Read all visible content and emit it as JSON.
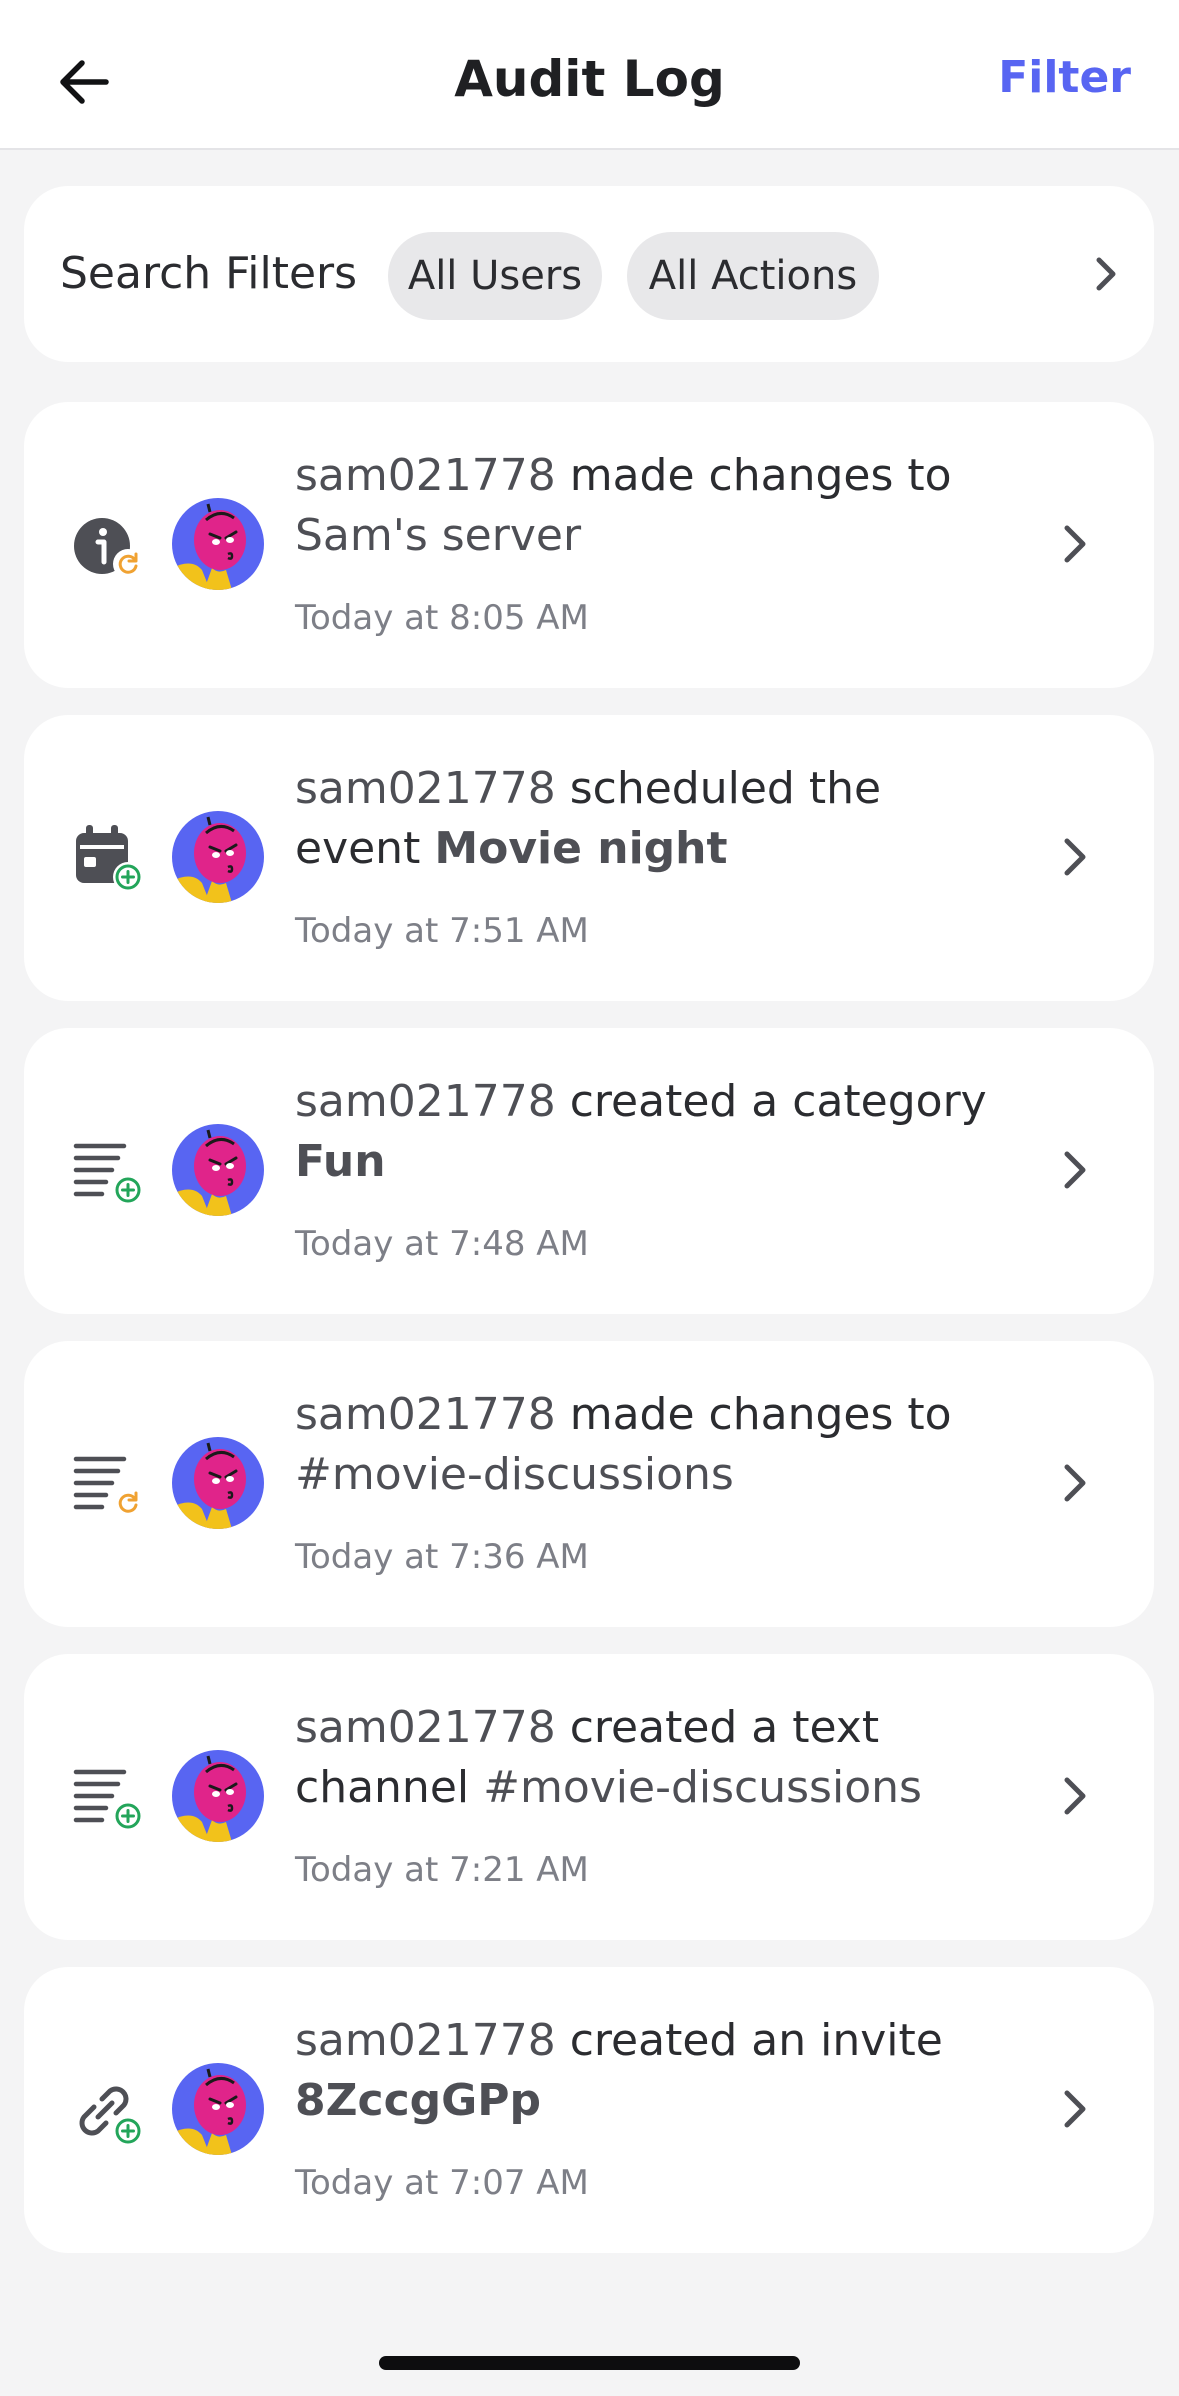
{
  "header": {
    "back_icon": "arrow-left-icon",
    "title": "Audit Log",
    "filter_label": "Filter"
  },
  "search": {
    "label": "Search Filters",
    "chips": [
      "All Users",
      "All Actions"
    ],
    "chevron_icon": "chevron-right-icon"
  },
  "entries": [
    {
      "icon": "server-update-icon",
      "badge": "update",
      "user": "sam021778",
      "action": "made changes to",
      "target": "Sam's server",
      "target_bold": false,
      "time": "Today at 8:05 AM"
    },
    {
      "icon": "calendar-add-icon",
      "badge": "create",
      "user": "sam021778",
      "action": "scheduled the event",
      "target": "Movie night",
      "target_bold": true,
      "time": "Today at 7:51 AM"
    },
    {
      "icon": "category-add-icon",
      "badge": "create",
      "user": "sam021778",
      "action": "created a category",
      "target": "Fun",
      "target_bold": true,
      "time": "Today at 7:48 AM"
    },
    {
      "icon": "channel-update-icon",
      "badge": "update",
      "user": "sam021778",
      "action": "made changes to",
      "target": "#movie-discussions",
      "target_bold": false,
      "time": "Today at 7:36 AM"
    },
    {
      "icon": "channel-add-icon",
      "badge": "create",
      "user": "sam021778",
      "action": "created a text channel",
      "target": "#movie-discussions",
      "target_bold": false,
      "time": "Today at 7:21 AM"
    },
    {
      "icon": "invite-link-add-icon",
      "badge": "create",
      "user": "sam021778",
      "action": "created an invite",
      "target": "8ZccgGPp",
      "target_bold": true,
      "time": "Today at 7:07 AM"
    }
  ],
  "colors": {
    "accent": "#5865f2",
    "create_badge": "#23a55a",
    "update_badge": "#f0a232",
    "avatar_bg": "#5865f2",
    "avatar_face": "#e0248a"
  }
}
